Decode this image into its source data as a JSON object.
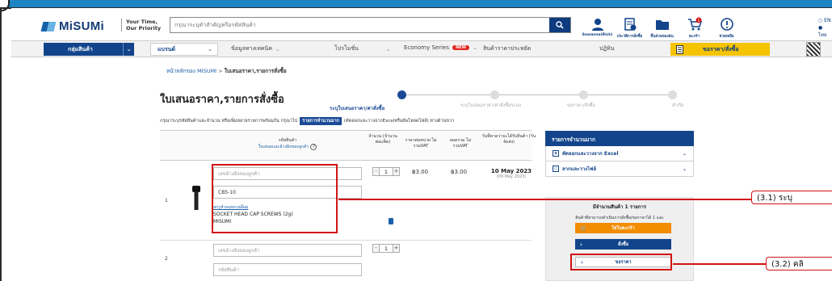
{
  "header": {
    "logo": "MiSUMi",
    "slogan_line1": "Your Time,",
    "slogan_line2": "Our Priority",
    "search_placeholder": "กรุณาระบุคำสำคัญหรือรหัสสินค้า",
    "icons": [
      {
        "name": "user-icon",
        "label": "Sowanna(Rick)"
      },
      {
        "name": "order-history-icon",
        "label": "ประวัติการสั่งซื้อ"
      },
      {
        "name": "folder-icon",
        "label": "ชิ้นส่วนของฉัน"
      },
      {
        "name": "cart-icon",
        "label": "ตะกร้า",
        "badge": "1"
      },
      {
        "name": "help-icon",
        "label": "ช่วยเหลือ"
      }
    ],
    "lang_en": "EN",
    "lang_th": "ไทย"
  },
  "nav": {
    "category": "กลุ่มสินค้า",
    "brand": "แบรนด์",
    "tech": "ข้อมูลทางเทคนิค",
    "promo": "โปรโมชั่น",
    "economy": "Economy Series",
    "economy_badge": "NEW",
    "saving": "สินค้าราคาประหยัด",
    "calendar": "ปฏิทิน",
    "order": "ขอราคา/สั่งซื้อ"
  },
  "breadcrumb": {
    "home": "หน้าหลักของ MISUMI",
    "sep": " > ",
    "current": "ใบเสนอราคา,รายการสั่งซื้อ"
  },
  "page_title": "ใบเสนอราคา,รายการสั่งซื้อ",
  "steps": [
    {
      "label": "ระบุใบเสนอราคา/ค่าสั่งซื้อ",
      "active": true
    },
    {
      "label": "ระบุใบเสนอราคา/ค่าสั่งซื้อระบบ",
      "active": false
    },
    {
      "label": "ขอราคา/สั่งซื้อ",
      "active": false
    },
    {
      "label": "สำเร็จ",
      "active": false
    }
  ],
  "intro": {
    "text_before": "กรุณาระบุรหัสสินค้าและจำนวน หรือเพิ่มหลายรายการพร้อมกัน กรุณาไป",
    "bulk_button": "รายการจำนวนมาก",
    "text_after": "(คัดลอกและวางจากExcelหรืออัพโหลดไฟล์) ทางด้านขวา"
  },
  "table_head": {
    "part_no": "รหัสสินค้า",
    "customer_ref": "ใบเสนอและอ้างอิงของลูกค้า",
    "qty": "จำนวน (จำนวนต่อแพ็ค)",
    "unit_price": "ราคาต่อหน่วย ไม่รวมVAT",
    "total": "ยอดรวม ไม่รวมVAT",
    "ship_date": "วันที่คาดว่าจะได้รับสินค้า (วันจัดส่ง)"
  },
  "rows": [
    {
      "num": "1",
      "ref_placeholder": "เลขอ้างอิงของลูกค้า",
      "part_no": "CB5-10",
      "qty": "1",
      "unit_price": "฿3.00",
      "total": "฿3.00",
      "date": "10 May 2023",
      "date_sub": "(09 May 2023)",
      "link": "สกรูหัวจมหกเหลี่ยม",
      "name": "SOCKET HEAD CAP SCREWS (2g)",
      "brand": "MISUMI"
    },
    {
      "num": "2",
      "ref_placeholder": "เลขอ้างอิงของลูกค้า",
      "part_placeholder": "รหัสสินค้า",
      "qty": "1"
    }
  ],
  "panel": {
    "title": "รายการจำนวนมาก",
    "opt_excel": "คัดลอกและวางจาก Excel",
    "opt_file": "ลากและวางไฟล์",
    "summary_title": "มีจำนวนสินค้า 1 รายการ",
    "summary_sub": "สินค้าที่สามารถดำเนินการสั่งซื้อ/ขอราคาได้ 1 และ",
    "btn_cart": "ใส่ในตะกร้า",
    "btn_order": "สั่งซื้อ",
    "btn_quote": "ขอราคา"
  },
  "callouts": {
    "c1": "(3.1) ระบุ",
    "c2": "(3.2) คลิ"
  },
  "colors": {
    "navy": "#12448b",
    "orange": "#f28c00",
    "yellow": "#f5c300",
    "highlight": "#d11414"
  }
}
